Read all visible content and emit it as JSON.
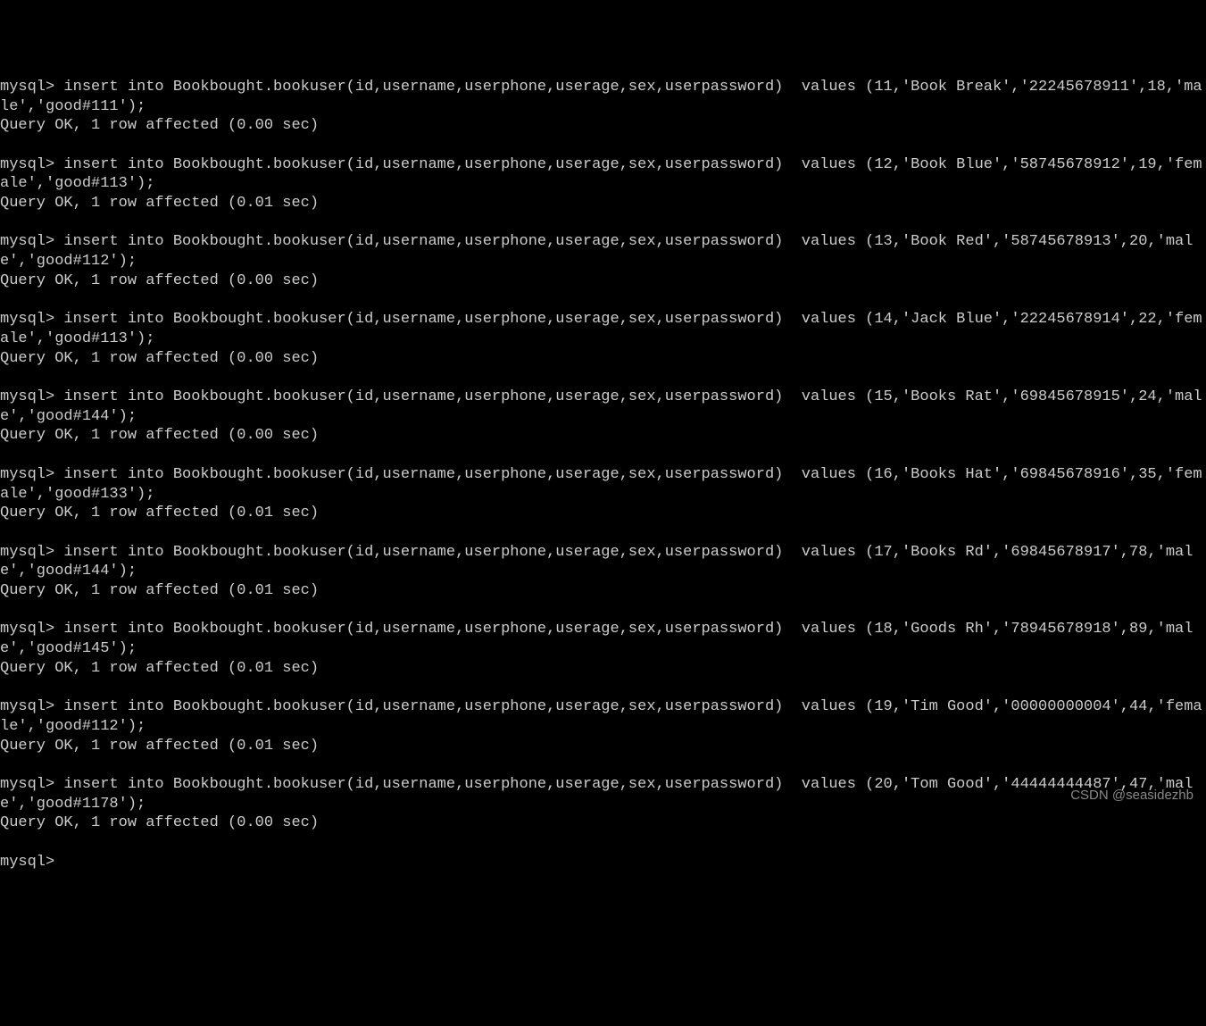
{
  "prompt": "mysql>",
  "insert_prefix": "insert into Bookbought.bookuser(id,username,userphone,userage,sex,userpassword)  values",
  "result_prefix": "Query OK, 1 row affected",
  "rows": [
    {
      "id": 11,
      "username": "Book Break",
      "userphone": "22245678911",
      "userage": 18,
      "sex": "male",
      "userpassword": "good#111",
      "sec": "0.00"
    },
    {
      "id": 12,
      "username": "Book Blue",
      "userphone": "58745678912",
      "userage": 19,
      "sex": "female",
      "userpassword": "good#113",
      "sec": "0.01"
    },
    {
      "id": 13,
      "username": "Book Red",
      "userphone": "58745678913",
      "userage": 20,
      "sex": "male",
      "userpassword": "good#112",
      "sec": "0.00"
    },
    {
      "id": 14,
      "username": "Jack Blue",
      "userphone": "22245678914",
      "userage": 22,
      "sex": "female",
      "userpassword": "good#113",
      "sec": "0.00"
    },
    {
      "id": 15,
      "username": "Books Rat",
      "userphone": "69845678915",
      "userage": 24,
      "sex": "male",
      "userpassword": "good#144",
      "sec": "0.00"
    },
    {
      "id": 16,
      "username": "Books Hat",
      "userphone": "69845678916",
      "userage": 35,
      "sex": "female",
      "userpassword": "good#133",
      "sec": "0.01"
    },
    {
      "id": 17,
      "username": "Books Rd",
      "userphone": "69845678917",
      "userage": 78,
      "sex": "male",
      "userpassword": "good#144",
      "sec": "0.01"
    },
    {
      "id": 18,
      "username": "Goods Rh",
      "userphone": "78945678918",
      "userage": 89,
      "sex": "male",
      "userpassword": "good#145",
      "sec": "0.01"
    },
    {
      "id": 19,
      "username": "Tim Good",
      "userphone": "00000000004",
      "userage": 44,
      "sex": "female",
      "userpassword": "good#112",
      "sec": "0.01"
    },
    {
      "id": 20,
      "username": "Tom Good",
      "userphone": "44444444487",
      "userage": 47,
      "sex": "male",
      "userpassword": "good#1178",
      "sec": "0.00"
    }
  ],
  "final_prompt": "mysql>",
  "watermark": "CSDN @seasidezhb"
}
